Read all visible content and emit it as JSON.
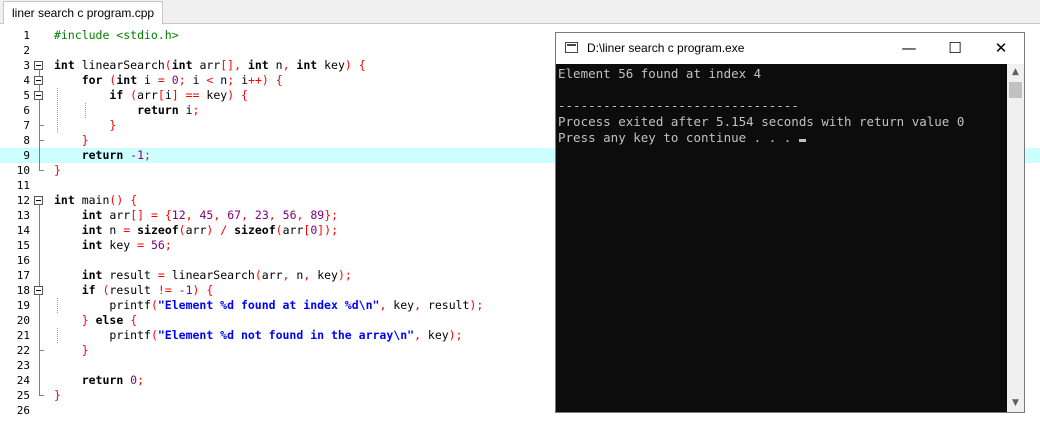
{
  "editor": {
    "tab_label": "liner search c program.cpp",
    "highlight_line": 9,
    "lines": [
      {
        "n": 1,
        "tokens": [
          {
            "t": "#include <stdio.h>",
            "c": "pp"
          }
        ]
      },
      {
        "n": 2,
        "tokens": []
      },
      {
        "n": 3,
        "tokens": [
          {
            "t": "int",
            "c": "kw"
          },
          {
            "t": " linearSearch",
            "c": ""
          },
          {
            "t": "(",
            "c": "sy"
          },
          {
            "t": "int",
            "c": "kw"
          },
          {
            "t": " arr",
            "c": ""
          },
          {
            "t": "[],",
            "c": "sy"
          },
          {
            "t": " int",
            "c": "kw"
          },
          {
            "t": " n",
            "c": ""
          },
          {
            "t": ",",
            "c": "sy"
          },
          {
            "t": " int",
            "c": "kw"
          },
          {
            "t": " key",
            "c": ""
          },
          {
            "t": ")",
            "c": "sy"
          },
          {
            "t": " {",
            "c": "sy"
          }
        ]
      },
      {
        "n": 4,
        "tokens": [
          {
            "t": "    ",
            "c": ""
          },
          {
            "t": "for",
            "c": "kw"
          },
          {
            "t": " (",
            "c": "sy"
          },
          {
            "t": "int",
            "c": "kw"
          },
          {
            "t": " i ",
            "c": ""
          },
          {
            "t": "=",
            "c": "sy"
          },
          {
            "t": " 0",
            "c": "nu"
          },
          {
            "t": ";",
            "c": "sy"
          },
          {
            "t": " i ",
            "c": ""
          },
          {
            "t": "<",
            "c": "sy"
          },
          {
            "t": " n",
            "c": ""
          },
          {
            "t": ";",
            "c": "sy"
          },
          {
            "t": " i",
            "c": ""
          },
          {
            "t": "++)",
            "c": "sy"
          },
          {
            "t": " {",
            "c": "sy"
          }
        ]
      },
      {
        "n": 5,
        "tokens": [
          {
            "t": "        ",
            "c": ""
          },
          {
            "t": "if",
            "c": "kw"
          },
          {
            "t": " (",
            "c": "sy"
          },
          {
            "t": "arr",
            "c": ""
          },
          {
            "t": "[",
            "c": "sy"
          },
          {
            "t": "i",
            "c": ""
          },
          {
            "t": "]",
            "c": "sy"
          },
          {
            "t": " ==",
            "c": "sy"
          },
          {
            "t": " key",
            "c": ""
          },
          {
            "t": ")",
            "c": "sy"
          },
          {
            "t": " {",
            "c": "sy"
          }
        ]
      },
      {
        "n": 6,
        "tokens": [
          {
            "t": "            ",
            "c": ""
          },
          {
            "t": "return",
            "c": "kw"
          },
          {
            "t": " i",
            "c": ""
          },
          {
            "t": ";",
            "c": "sy"
          }
        ]
      },
      {
        "n": 7,
        "tokens": [
          {
            "t": "        ",
            "c": ""
          },
          {
            "t": "}",
            "c": "sy"
          }
        ]
      },
      {
        "n": 8,
        "tokens": [
          {
            "t": "    ",
            "c": ""
          },
          {
            "t": "}",
            "c": "sy"
          }
        ]
      },
      {
        "n": 9,
        "tokens": [
          {
            "t": "    ",
            "c": ""
          },
          {
            "t": "return",
            "c": "kw"
          },
          {
            "t": " -1",
            "c": "nu"
          },
          {
            "t": ";",
            "c": "sy"
          }
        ]
      },
      {
        "n": 10,
        "tokens": [
          {
            "t": "}",
            "c": "sy"
          }
        ]
      },
      {
        "n": 11,
        "tokens": []
      },
      {
        "n": 12,
        "tokens": [
          {
            "t": "int",
            "c": "kw"
          },
          {
            "t": " main",
            "c": ""
          },
          {
            "t": "()",
            "c": "sy"
          },
          {
            "t": " {",
            "c": "sy"
          }
        ]
      },
      {
        "n": 13,
        "tokens": [
          {
            "t": "    ",
            "c": ""
          },
          {
            "t": "int",
            "c": "kw"
          },
          {
            "t": " arr",
            "c": ""
          },
          {
            "t": "[]",
            "c": "sy"
          },
          {
            "t": " =",
            "c": "sy"
          },
          {
            "t": " {",
            "c": "sy"
          },
          {
            "t": "12",
            "c": "nu"
          },
          {
            "t": ",",
            "c": "sy"
          },
          {
            "t": " 45",
            "c": "nu"
          },
          {
            "t": ",",
            "c": "sy"
          },
          {
            "t": " 67",
            "c": "nu"
          },
          {
            "t": ",",
            "c": "sy"
          },
          {
            "t": " 23",
            "c": "nu"
          },
          {
            "t": ",",
            "c": "sy"
          },
          {
            "t": " 56",
            "c": "nu"
          },
          {
            "t": ",",
            "c": "sy"
          },
          {
            "t": " 89",
            "c": "nu"
          },
          {
            "t": "};",
            "c": "sy"
          }
        ]
      },
      {
        "n": 14,
        "tokens": [
          {
            "t": "    ",
            "c": ""
          },
          {
            "t": "int",
            "c": "kw"
          },
          {
            "t": " n ",
            "c": ""
          },
          {
            "t": "=",
            "c": "sy"
          },
          {
            "t": " sizeof",
            "c": "kw"
          },
          {
            "t": "(",
            "c": "sy"
          },
          {
            "t": "arr",
            "c": ""
          },
          {
            "t": ")",
            "c": "sy"
          },
          {
            "t": " /",
            "c": "sy"
          },
          {
            "t": " sizeof",
            "c": "kw"
          },
          {
            "t": "(",
            "c": "sy"
          },
          {
            "t": "arr",
            "c": ""
          },
          {
            "t": "[",
            "c": "sy"
          },
          {
            "t": "0",
            "c": "nu"
          },
          {
            "t": "]);",
            "c": "sy"
          }
        ]
      },
      {
        "n": 15,
        "tokens": [
          {
            "t": "    ",
            "c": ""
          },
          {
            "t": "int",
            "c": "kw"
          },
          {
            "t": " key ",
            "c": ""
          },
          {
            "t": "=",
            "c": "sy"
          },
          {
            "t": " 56",
            "c": "nu"
          },
          {
            "t": ";",
            "c": "sy"
          }
        ]
      },
      {
        "n": 16,
        "tokens": []
      },
      {
        "n": 17,
        "tokens": [
          {
            "t": "    ",
            "c": ""
          },
          {
            "t": "int",
            "c": "kw"
          },
          {
            "t": " result ",
            "c": ""
          },
          {
            "t": "=",
            "c": "sy"
          },
          {
            "t": " linearSearch",
            "c": ""
          },
          {
            "t": "(",
            "c": "sy"
          },
          {
            "t": "arr",
            "c": ""
          },
          {
            "t": ",",
            "c": "sy"
          },
          {
            "t": " n",
            "c": ""
          },
          {
            "t": ",",
            "c": "sy"
          },
          {
            "t": " key",
            "c": ""
          },
          {
            "t": ");",
            "c": "sy"
          }
        ]
      },
      {
        "n": 18,
        "tokens": [
          {
            "t": "    ",
            "c": ""
          },
          {
            "t": "if",
            "c": "kw"
          },
          {
            "t": " (",
            "c": "sy"
          },
          {
            "t": "result ",
            "c": ""
          },
          {
            "t": "!=",
            "c": "sy"
          },
          {
            "t": " -1",
            "c": "nu"
          },
          {
            "t": ")",
            "c": "sy"
          },
          {
            "t": " {",
            "c": "sy"
          }
        ]
      },
      {
        "n": 19,
        "tokens": [
          {
            "t": "        ",
            "c": ""
          },
          {
            "t": "printf",
            "c": ""
          },
          {
            "t": "(",
            "c": "sy"
          },
          {
            "t": "\"Element %d found at index %d\\n\"",
            "c": "st"
          },
          {
            "t": ",",
            "c": "sy"
          },
          {
            "t": " key",
            "c": ""
          },
          {
            "t": ",",
            "c": "sy"
          },
          {
            "t": " result",
            "c": ""
          },
          {
            "t": ");",
            "c": "sy"
          }
        ]
      },
      {
        "n": 20,
        "tokens": [
          {
            "t": "    ",
            "c": ""
          },
          {
            "t": "}",
            "c": "sy"
          },
          {
            "t": " else",
            "c": "kw"
          },
          {
            "t": " {",
            "c": "sy"
          }
        ]
      },
      {
        "n": 21,
        "tokens": [
          {
            "t": "        ",
            "c": ""
          },
          {
            "t": "printf",
            "c": ""
          },
          {
            "t": "(",
            "c": "sy"
          },
          {
            "t": "\"Element %d not found in the array\\n\"",
            "c": "st"
          },
          {
            "t": ",",
            "c": "sy"
          },
          {
            "t": " key",
            "c": ""
          },
          {
            "t": ");",
            "c": "sy"
          }
        ]
      },
      {
        "n": 22,
        "tokens": [
          {
            "t": "    ",
            "c": ""
          },
          {
            "t": "}",
            "c": "sy"
          }
        ]
      },
      {
        "n": 23,
        "tokens": []
      },
      {
        "n": 24,
        "tokens": [
          {
            "t": "    ",
            "c": ""
          },
          {
            "t": "return",
            "c": "kw"
          },
          {
            "t": " 0",
            "c": "nu"
          },
          {
            "t": ";",
            "c": "sy"
          }
        ]
      },
      {
        "n": 25,
        "tokens": [
          {
            "t": "}",
            "c": "sy"
          }
        ]
      },
      {
        "n": 26,
        "tokens": []
      }
    ]
  },
  "console": {
    "title": "D:\\liner search c program.exe",
    "minimize_glyph": "—",
    "maximize_glyph": "☐",
    "close_glyph": "✕",
    "scroll_up_glyph": "▲",
    "scroll_down_glyph": "▼",
    "lines": [
      "Element 56 found at index 4",
      "",
      "--------------------------------",
      "Process exited after 5.154 seconds with return value 0",
      "Press any key to continue . . . "
    ]
  },
  "colors": {
    "highlight_row": "#ccffff",
    "keyword": "#000000",
    "preprocessor": "#008000",
    "symbol": "#ff0000",
    "number": "#800080",
    "string": "#0000ff",
    "terminal_bg": "#0c0c0c",
    "terminal_fg": "#c0c0c0"
  }
}
